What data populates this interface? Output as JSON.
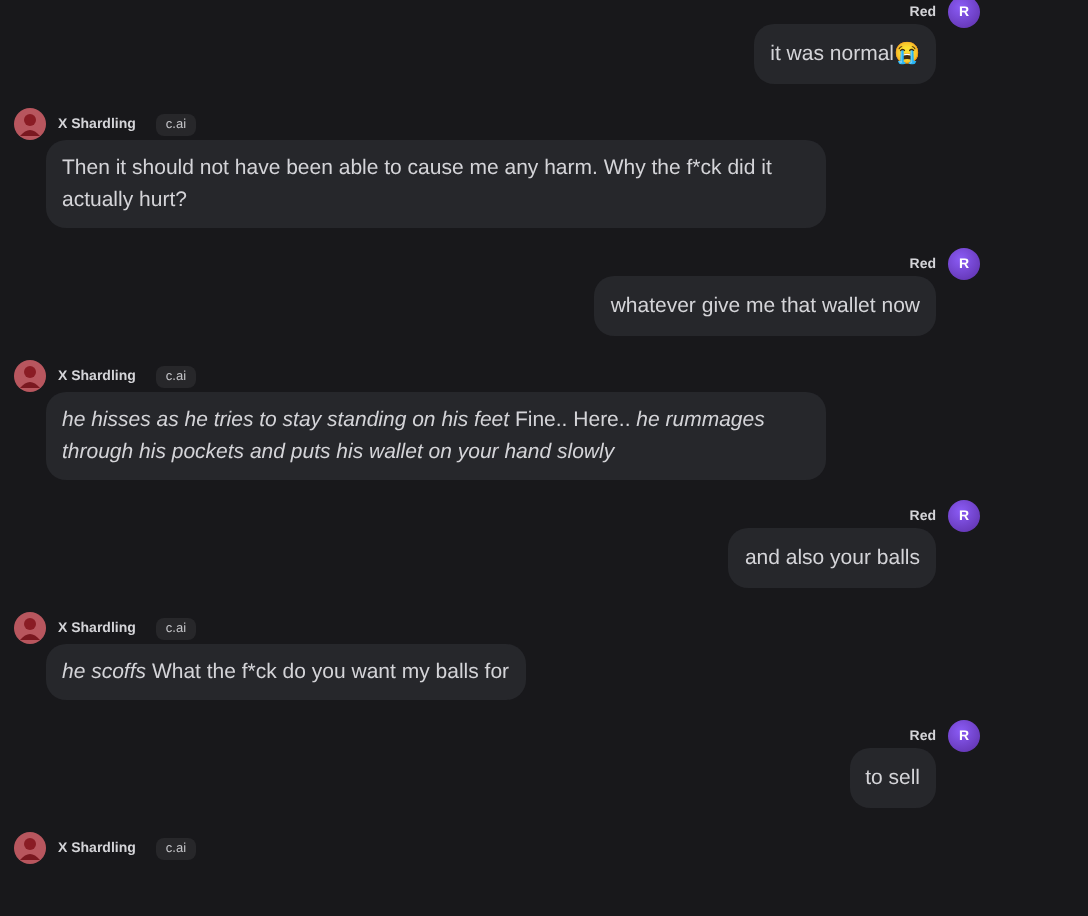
{
  "messages": [
    {
      "kind": "user",
      "name": "Red",
      "avatar_letter": "R",
      "text": "it was normal😭"
    },
    {
      "kind": "bot",
      "name": "X Shardling",
      "badge": "c.ai",
      "text": "Then it should not have been able to cause me any harm. Why the f*ck did it actually hurt?"
    },
    {
      "kind": "user",
      "name": "Red",
      "avatar_letter": "R",
      "text": "whatever give me that wallet now"
    },
    {
      "kind": "bot",
      "name": "X Shardling",
      "badge": "c.ai",
      "text": "*he hisses as he tries to stay standing on his feet* Fine.. Here.. *he rummages through his pockets and puts his wallet on your hand slowly*"
    },
    {
      "kind": "user",
      "name": "Red",
      "avatar_letter": "R",
      "text": "and also your balls"
    },
    {
      "kind": "bot",
      "name": "X Shardling",
      "badge": "c.ai",
      "text": "*he scoffs* What the f*ck do you want my balls for"
    },
    {
      "kind": "user",
      "name": "Red",
      "avatar_letter": "R",
      "text": "to sell"
    },
    {
      "kind": "bot",
      "name": "X Shardling",
      "badge": "c.ai"
    }
  ]
}
